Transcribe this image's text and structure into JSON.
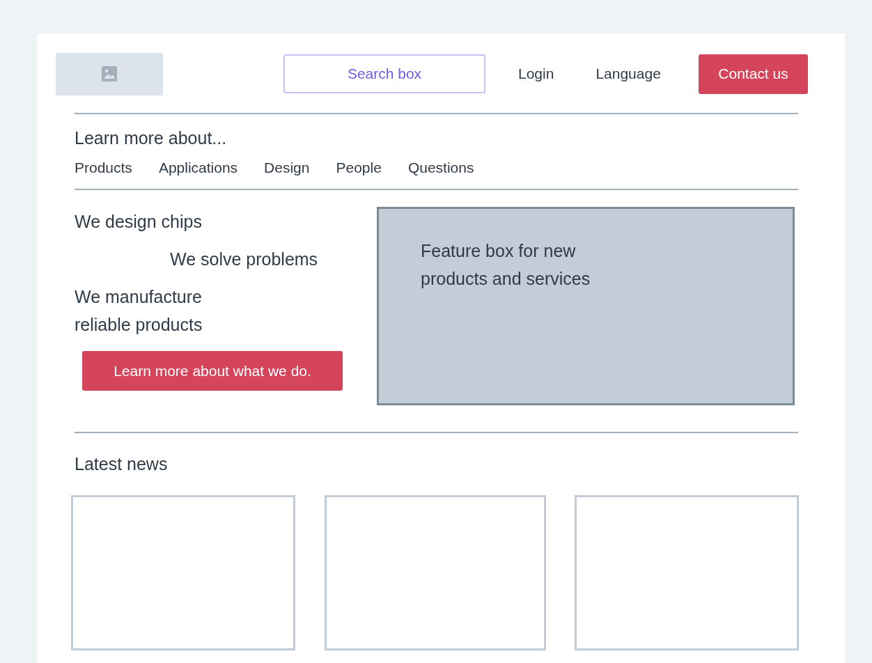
{
  "header": {
    "search": {
      "placeholder": "Search box"
    },
    "links": [
      {
        "label": "Login"
      },
      {
        "label": "Language"
      }
    ],
    "contact_button": "Contact us"
  },
  "subnav": {
    "heading": "Learn more about...",
    "items": [
      "Products",
      "Applications",
      "Design",
      "People",
      "Questions"
    ]
  },
  "hero": {
    "taglines": [
      {
        "text": "We design chips",
        "indented": false
      },
      {
        "text": "We solve problems",
        "indented": true
      },
      {
        "text": "We manufacture\nreliable products",
        "indented": false
      }
    ],
    "button": "Learn more about what we do.",
    "feature": "Feature box for new\nproducts and services"
  },
  "news": {
    "heading": "Latest news",
    "cards": [
      {
        "kind": "empty"
      },
      {
        "kind": "empty"
      },
      {
        "kind": "empty"
      }
    ]
  }
}
